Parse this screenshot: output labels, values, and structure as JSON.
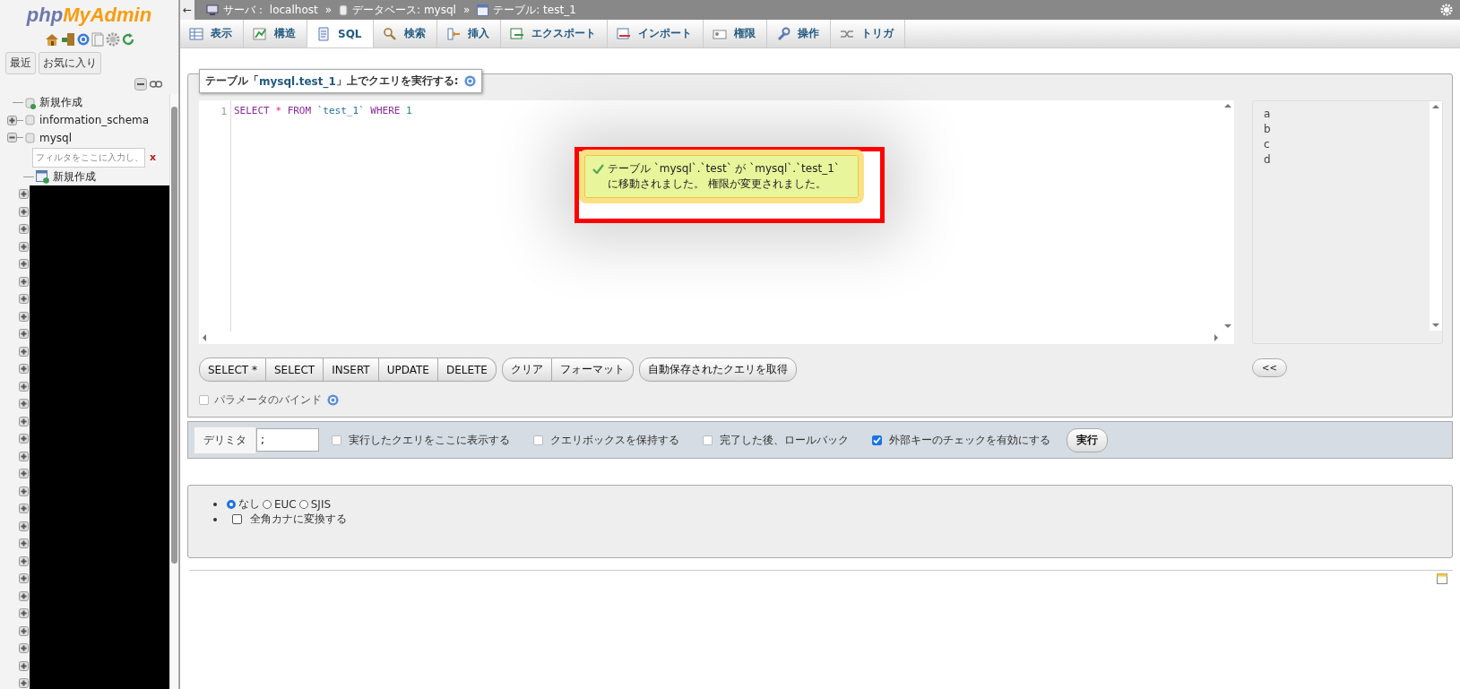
{
  "sidebar": {
    "logo": {
      "prefix": "php",
      "suffix": "MyAdmin"
    },
    "tabs": [
      {
        "label": "最近",
        "selected": false
      },
      {
        "label": "お気に入り",
        "selected": false
      }
    ],
    "tree": [
      {
        "kind": "new",
        "label": "新規作成"
      },
      {
        "kind": "db",
        "label": "information_schema",
        "expanded": false
      },
      {
        "kind": "db",
        "label": "mysql",
        "expanded": true,
        "filter": {
          "placeholder": "フィルタをここに入力し、",
          "clear": "x"
        },
        "children": [
          {
            "kind": "new",
            "label": "新規作成"
          }
        ],
        "redacted_tables": [
          {
            "expanded": false
          },
          {
            "expanded": false
          },
          {
            "expanded": false
          },
          {
            "expanded": false
          },
          {
            "expanded": false
          },
          {
            "expanded": false
          },
          {
            "expanded": false
          },
          {
            "expanded": false
          },
          {
            "expanded": false
          },
          {
            "expanded": false
          },
          {
            "expanded": false
          },
          {
            "expanded": false
          },
          {
            "expanded": false
          },
          {
            "expanded": false
          },
          {
            "expanded": false
          },
          {
            "expanded": false
          },
          {
            "expanded": false
          },
          {
            "expanded": false
          },
          {
            "expanded": false
          },
          {
            "expanded": false
          },
          {
            "expanded": false
          },
          {
            "expanded": false
          },
          {
            "expanded": false
          },
          {
            "expanded": false
          },
          {
            "expanded": false
          },
          {
            "expanded": false
          },
          {
            "expanded": false
          },
          {
            "expanded": false
          },
          {
            "expanded": false
          }
        ]
      }
    ]
  },
  "topbar": {
    "back": "←",
    "breadcrumbs": [
      {
        "kind": "server",
        "label": "サーバ： localhost"
      },
      {
        "kind": "database",
        "label": "データベース: mysql",
        "separator": "»"
      },
      {
        "kind": "table",
        "label": "テーブル: test_1",
        "separator": "»"
      }
    ]
  },
  "tabs": [
    {
      "kind": "browse",
      "label": "表示",
      "selected": false
    },
    {
      "kind": "structure",
      "label": "構造",
      "selected": false
    },
    {
      "kind": "sql",
      "label": "SQL",
      "selected": true
    },
    {
      "kind": "search",
      "label": "検索",
      "selected": false
    },
    {
      "kind": "insert",
      "label": "挿入",
      "selected": false
    },
    {
      "kind": "export",
      "label": "エクスポート",
      "selected": false
    },
    {
      "kind": "import",
      "label": "インポート",
      "selected": false
    },
    {
      "kind": "privileges",
      "label": "権限",
      "selected": false
    },
    {
      "kind": "operations",
      "label": "操作",
      "selected": false
    },
    {
      "kind": "triggers",
      "label": "トリガ",
      "selected": false
    }
  ],
  "query": {
    "legend": {
      "before": "テーブル「",
      "link": "mysql.test_1",
      "after": "」上でクエリを実行する:"
    },
    "editor": {
      "line_number": "1",
      "tokens": [
        {
          "kind": "keyword",
          "text": "SELECT"
        },
        {
          "kind": "operator",
          "text": "*"
        },
        {
          "kind": "keyword",
          "text": "FROM"
        },
        {
          "kind": "identifier",
          "text": "`test_1`"
        },
        {
          "kind": "keyword",
          "text": "WHERE"
        },
        {
          "kind": "number",
          "text": "1"
        }
      ]
    },
    "columns": [
      "a",
      "b",
      "c",
      "d"
    ],
    "insert_button": "<<",
    "button_groups": [
      [
        "SELECT *",
        "SELECT",
        "INSERT",
        "UPDATE",
        "DELETE"
      ],
      [
        "クリア",
        "フォーマット"
      ],
      [
        "自動保存されたクエリを取得"
      ]
    ],
    "bind_parameters": {
      "label": "パラメータのバインド",
      "checked": false
    }
  },
  "footer": {
    "delimiter": {
      "label": "デリミタ",
      "value": ";"
    },
    "options": [
      {
        "label": "実行したクエリをここに表示する",
        "checked": false
      },
      {
        "label": "クエリボックスを保持する",
        "checked": false
      },
      {
        "label": "完了した後、ロールバック",
        "checked": false
      },
      {
        "label": "外部キーのチェックを有効にする",
        "checked": true
      }
    ],
    "submit": "実行"
  },
  "charset": {
    "encodings": [
      {
        "label": "なし",
        "selected": true
      },
      {
        "label": "EUC",
        "selected": false
      },
      {
        "label": "SJIS",
        "selected": false
      }
    ],
    "kana": {
      "label": "全角カナに変換する",
      "checked": false
    }
  },
  "notification": {
    "kind": "success",
    "highlighted": true,
    "message": "テーブル `mysql`.`test` が `mysql`.`test_1`\nに移動されました。 権限が変更されました。"
  }
}
